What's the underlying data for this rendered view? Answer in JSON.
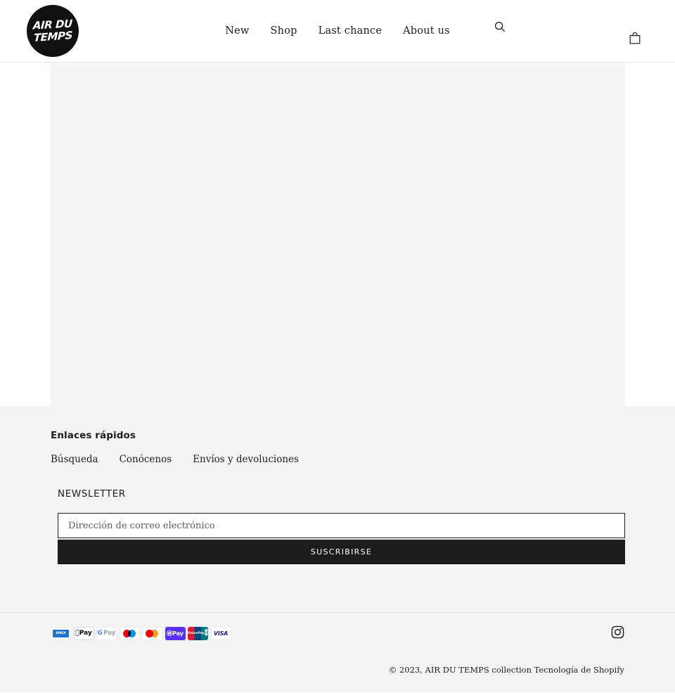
{
  "header": {
    "logo": {
      "name": "AIR DU TEMPS",
      "line1": "AIR DU",
      "line2": "TEMPS"
    },
    "nav": [
      {
        "label": "New"
      },
      {
        "label": "Shop"
      },
      {
        "label": "Last chance"
      },
      {
        "label": "About us"
      }
    ],
    "search_icon": "search-icon",
    "cart_icon": "shopping-bag-icon"
  },
  "main": {
    "placeholder_block": ""
  },
  "footer": {
    "quick_links_heading": "Enlaces rápidos",
    "quick_links": [
      {
        "label": "Búsqueda"
      },
      {
        "label": "Conócenos"
      },
      {
        "label": "Envíos y devoluciones"
      }
    ],
    "newsletter": {
      "title": "NEWSLETTER",
      "email_placeholder": "Dirección de correo electrónico",
      "email_value": "",
      "submit_label": "SUSCRIBIRSE"
    },
    "payments": [
      {
        "name": "american-express",
        "label": "AMEX"
      },
      {
        "name": "apple-pay",
        "label": "Pay"
      },
      {
        "name": "google-pay",
        "label_g": "G",
        "label_pay": "Pay"
      },
      {
        "name": "maestro",
        "label": ""
      },
      {
        "name": "mastercard",
        "label": ""
      },
      {
        "name": "shop-pay",
        "label": "Pay"
      },
      {
        "name": "union-pay",
        "line1": "UnionPay",
        "line2": "銀聯"
      },
      {
        "name": "visa",
        "label": "VISA"
      }
    ],
    "social": [
      {
        "name": "instagram",
        "label": "Instagram"
      }
    ],
    "copyright": "© 2023, AIR DU TEMPS collection",
    "powered_by": "Tecnología de Shopify"
  },
  "colors": {
    "accent": "#1c1d1d",
    "button_bg": "#1c1c1c",
    "page_bg": "#ffffff",
    "block_bg": "#f5f5f5",
    "footer_bg": "#f4f4f4"
  }
}
